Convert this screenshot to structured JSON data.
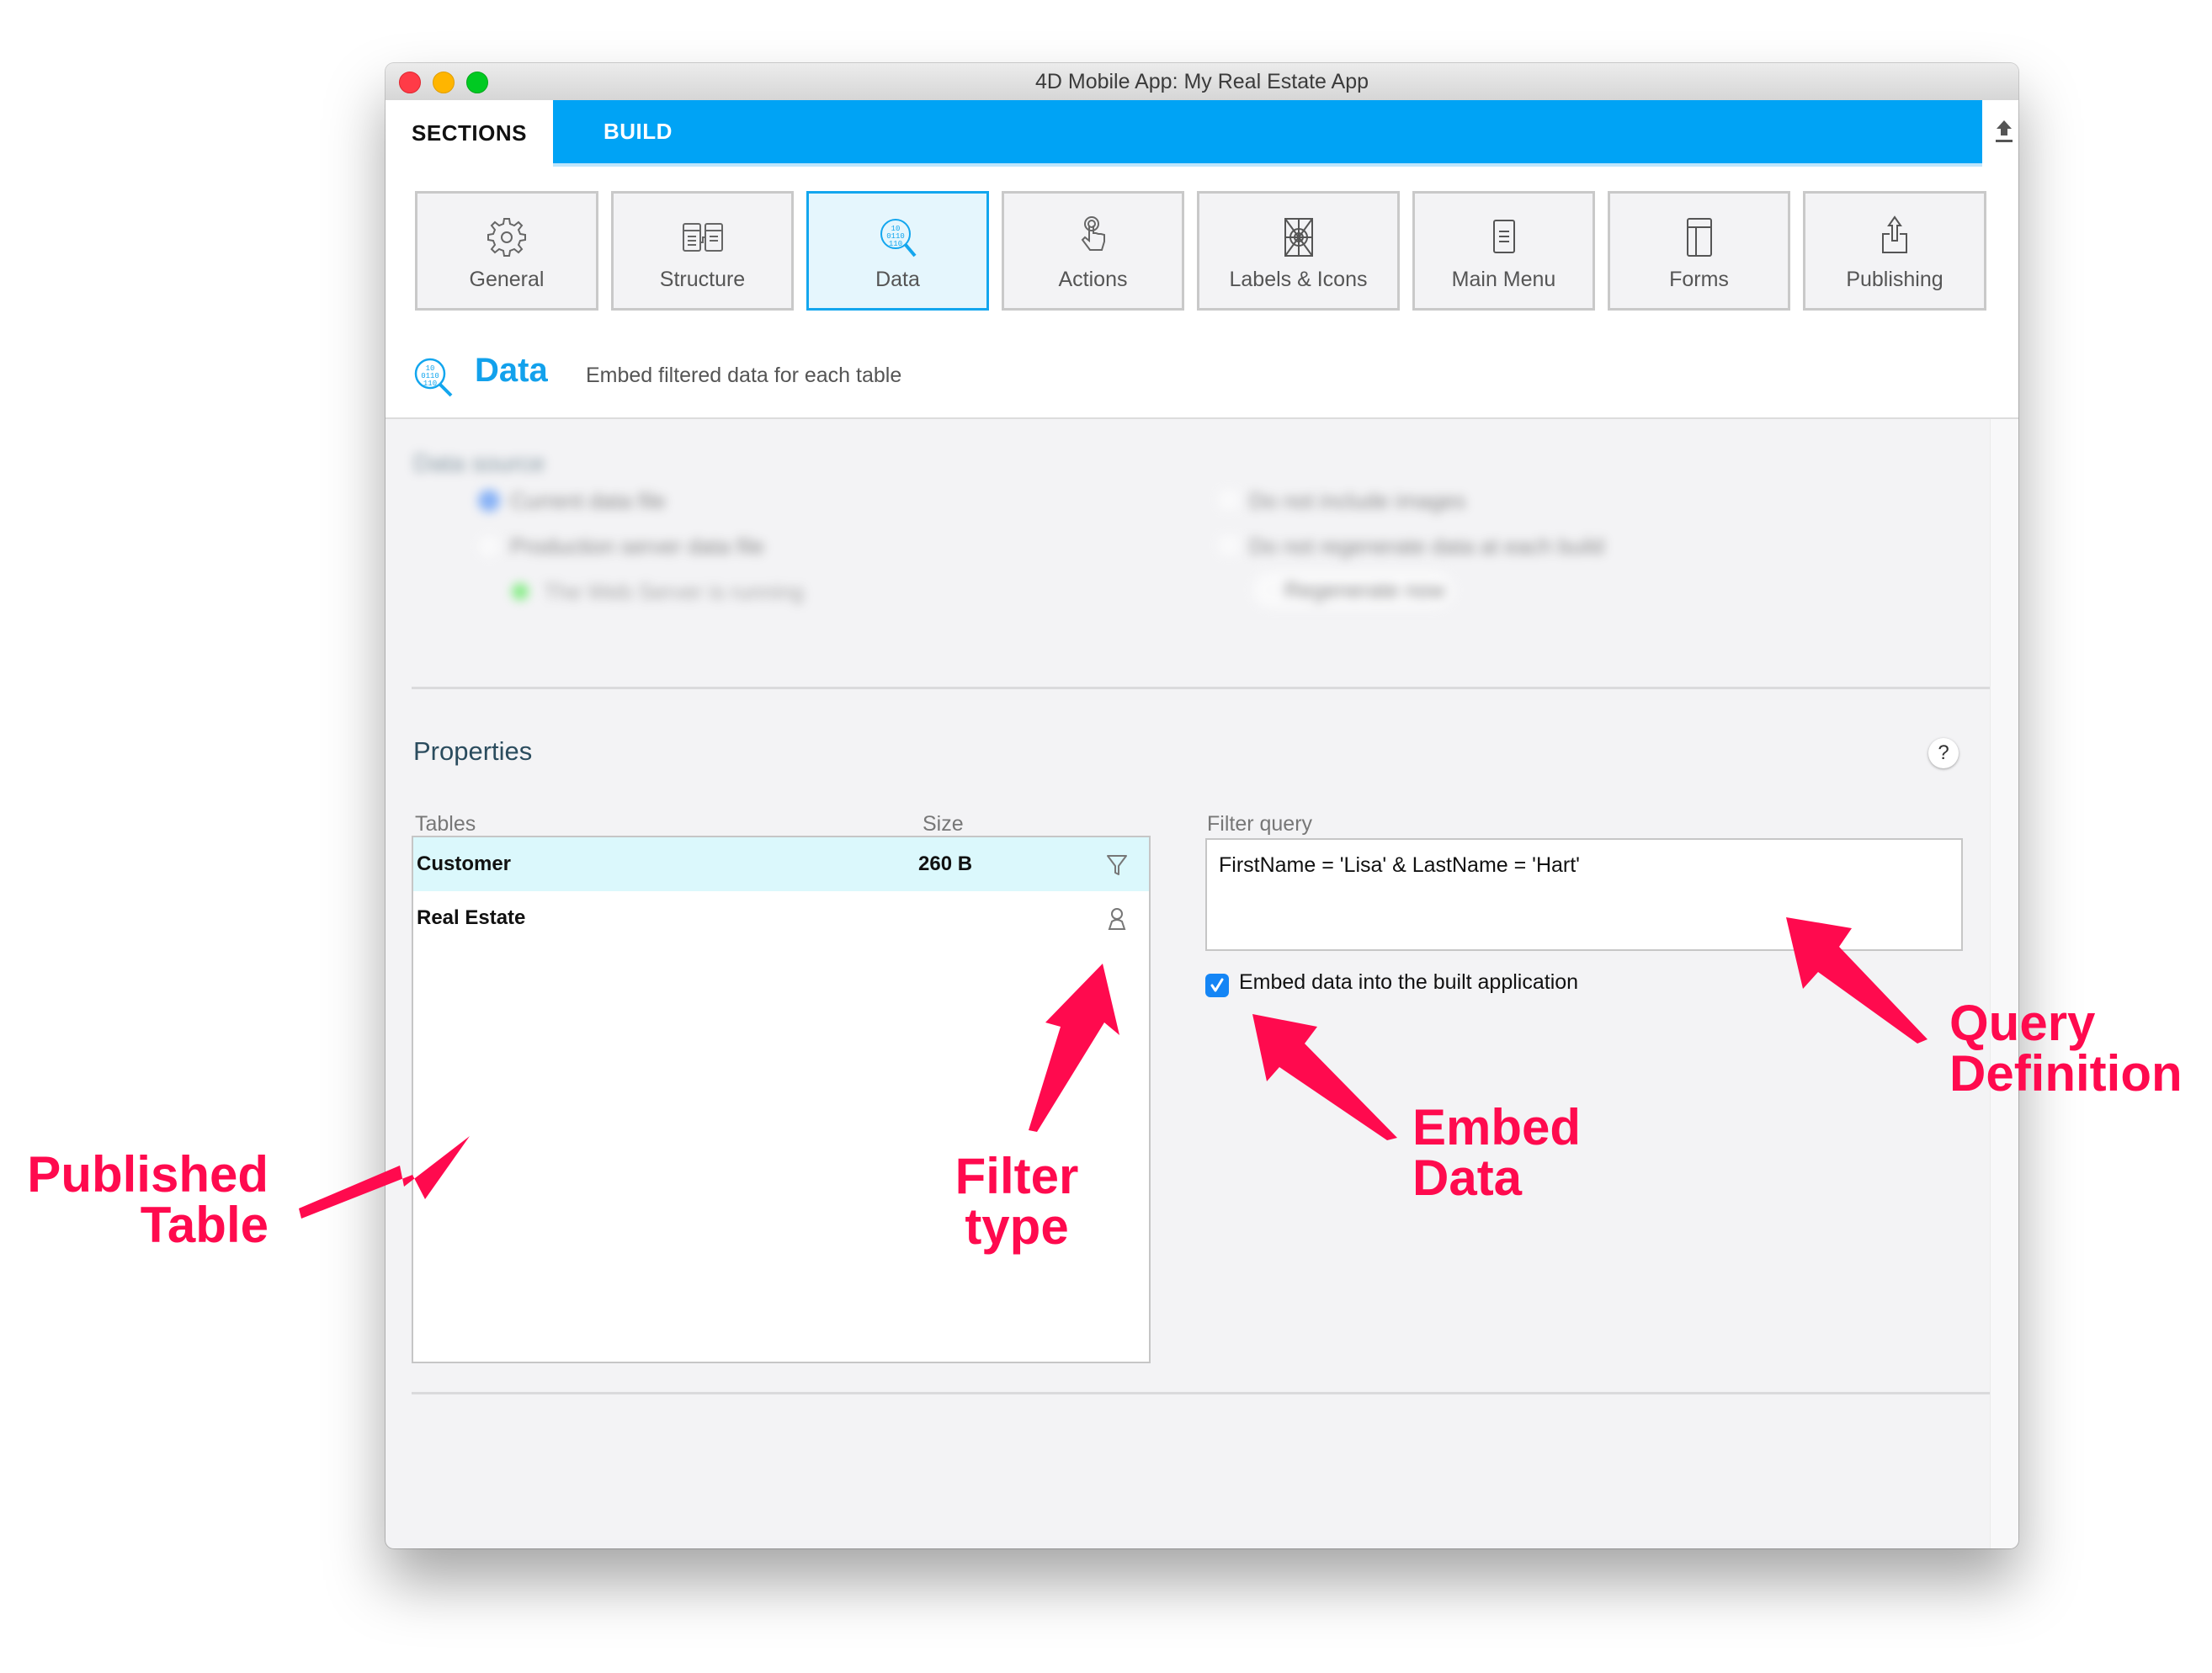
{
  "window": {
    "title": "4D Mobile App: My Real Estate App"
  },
  "top_tabs": {
    "sections": "SECTIONS",
    "build": "BUILD",
    "upload_icon": "upload-icon"
  },
  "section_tiles": [
    {
      "label": "General",
      "icon": "gear-icon",
      "active": false
    },
    {
      "label": "Structure",
      "icon": "structure-icon",
      "active": false
    },
    {
      "label": "Data",
      "icon": "data-search-icon",
      "active": true
    },
    {
      "label": "Actions",
      "icon": "touch-hand-icon",
      "active": false
    },
    {
      "label": "Labels & Icons",
      "icon": "labels-icons-icon",
      "active": false
    },
    {
      "label": "Main Menu",
      "icon": "menu-icon",
      "active": false
    },
    {
      "label": "Forms",
      "icon": "forms-icon",
      "active": false
    },
    {
      "label": "Publishing",
      "icon": "share-icon",
      "active": false
    }
  ],
  "page_header": {
    "title": "Data",
    "subtitle": "Embed filtered data for each table"
  },
  "data_source_blurred": {
    "title": "Data source",
    "options": [
      "Current data file",
      "Production server data file"
    ],
    "server_status": "The Web Server is running",
    "right_options": [
      "Do not include images",
      "Do not regenerate data at each build"
    ],
    "regenerate_button": "Regenerate now"
  },
  "properties": {
    "title": "Properties",
    "help_label": "?",
    "tables_header": "Tables",
    "size_header": "Size",
    "tables": [
      {
        "name": "Customer",
        "size": "260 B",
        "filter_icon": "filter-funnel-icon",
        "selected": true
      },
      {
        "name": "Real Estate",
        "size": "",
        "filter_icon": "user-filter-icon",
        "selected": false
      }
    ],
    "filter_query_label": "Filter query",
    "filter_query_value": "FirstName = 'Lisa' & LastName = 'Hart'",
    "embed_checkbox_label": "Embed data into the built application",
    "embed_checked": true
  },
  "annotations": {
    "published_table": [
      "Published",
      "Table"
    ],
    "filter_type": [
      "Filter",
      "type"
    ],
    "embed_data": [
      "Embed",
      "Data"
    ],
    "query_definition": [
      "Query",
      "Definition"
    ]
  },
  "colors": {
    "accent_blue": "#00a3f5",
    "annotation_red": "#ff0a4e",
    "selected_row": "#dbf8fc",
    "checkbox_blue": "#1485f5"
  }
}
